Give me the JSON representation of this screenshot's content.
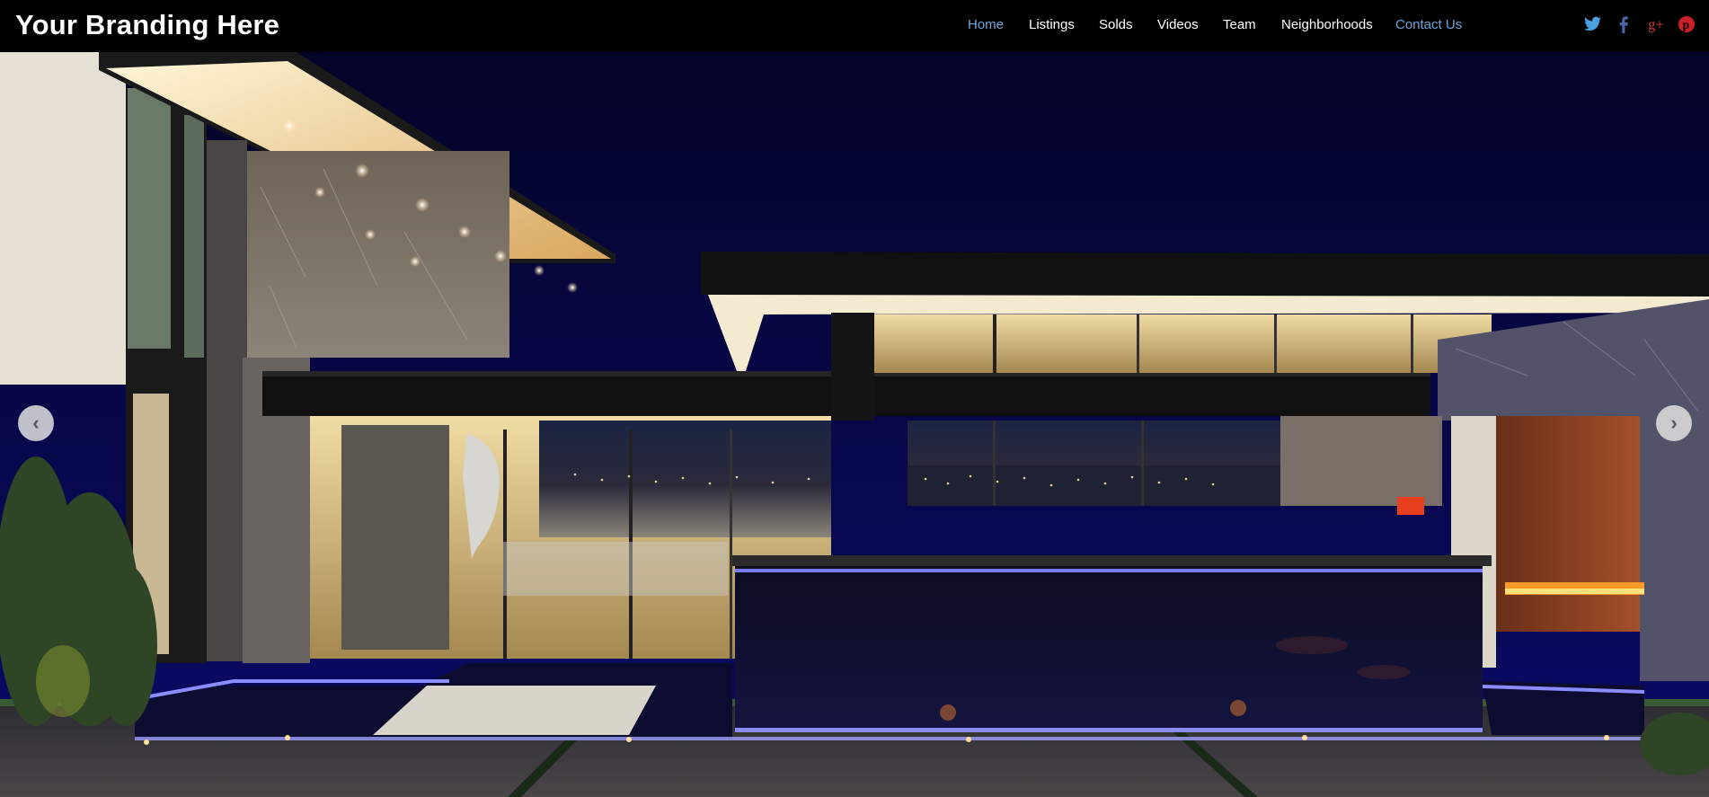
{
  "header": {
    "brand": "Your Branding Here",
    "nav": [
      {
        "label": "Home",
        "state": "active"
      },
      {
        "label": "Listings",
        "state": "normal"
      },
      {
        "label": "Solds",
        "state": "normal"
      },
      {
        "label": "Videos",
        "state": "normal"
      },
      {
        "label": "Team",
        "state": "normal"
      },
      {
        "label": "Neighborhoods",
        "state": "normal"
      },
      {
        "label": "Contact Us",
        "state": "highlight"
      }
    ],
    "social": [
      {
        "name": "twitter-icon",
        "color": "#4a9fe0"
      },
      {
        "name": "facebook-icon",
        "color": "#4766a8"
      },
      {
        "name": "google-plus-icon",
        "color": "#d23b2e"
      },
      {
        "name": "pinterest-icon",
        "color": "#cb2027"
      }
    ]
  },
  "colors": {
    "nav_active": "#6ea6dc",
    "nav_text": "#ffffff",
    "header_bg": "#000000"
  },
  "slider": {
    "prev_glyph": "‹",
    "next_glyph": "›",
    "image_alt": "Modern luxury home at night with city lights view"
  }
}
